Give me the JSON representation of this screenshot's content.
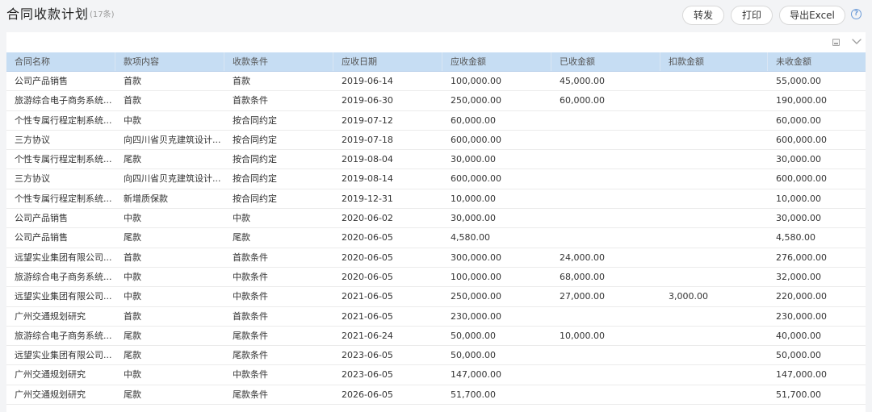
{
  "header": {
    "title": "合同收款计划",
    "count": "(17条)",
    "buttons": {
      "forward": "转发",
      "print": "打印",
      "export": "导出Excel"
    },
    "help_glyph": "?"
  },
  "toolbar": {
    "icons": [
      "print-icon",
      "chevron-down-icon"
    ]
  },
  "colors": {
    "header_bg": "#c6ddf3",
    "accent": "#6b9bd8"
  },
  "table": {
    "columns": [
      "合同名称",
      "款项内容",
      "收款条件",
      "应收日期",
      "应收金额",
      "已收金额",
      "扣款金额",
      "未收金额"
    ],
    "rows": [
      [
        "公司产品销售",
        "首款",
        "首款",
        "2019-06-14",
        "100,000.00",
        "45,000.00",
        "",
        "55,000.00"
      ],
      [
        "旅游综合电子商务系统...",
        "首款",
        "首款条件",
        "2019-06-30",
        "250,000.00",
        "60,000.00",
        "",
        "190,000.00"
      ],
      [
        "个性专属行程定制系统...",
        "中款",
        "按合同约定",
        "2019-07-12",
        "60,000.00",
        "",
        "",
        "60,000.00"
      ],
      [
        "三方协议",
        "向四川省贝克建筑设计...",
        "按合同约定",
        "2019-07-18",
        "600,000.00",
        "",
        "",
        "600,000.00"
      ],
      [
        "个性专属行程定制系统...",
        "尾款",
        "按合同约定",
        "2019-08-04",
        "30,000.00",
        "",
        "",
        "30,000.00"
      ],
      [
        "三方协议",
        "向四川省贝克建筑设计...",
        "按合同约定",
        "2019-08-14",
        "600,000.00",
        "",
        "",
        "600,000.00"
      ],
      [
        "个性专属行程定制系统...",
        "新增质保款",
        "按合同约定",
        "2019-12-31",
        "10,000.00",
        "",
        "",
        "10,000.00"
      ],
      [
        "公司产品销售",
        "中款",
        "中款",
        "2020-06-02",
        "30,000.00",
        "",
        "",
        "30,000.00"
      ],
      [
        "公司产品销售",
        "尾款",
        "尾款",
        "2020-06-05",
        "4,580.00",
        "",
        "",
        "4,580.00"
      ],
      [
        "远望实业集团有限公司...",
        "首款",
        "首款条件",
        "2020-06-05",
        "300,000.00",
        "24,000.00",
        "",
        "276,000.00"
      ],
      [
        "旅游综合电子商务系统...",
        "中款",
        "中款条件",
        "2020-06-05",
        "100,000.00",
        "68,000.00",
        "",
        "32,000.00"
      ],
      [
        "远望实业集团有限公司...",
        "中款",
        "中款条件",
        "2021-06-05",
        "250,000.00",
        "27,000.00",
        "3,000.00",
        "220,000.00"
      ],
      [
        "广州交通规划研究",
        "首款",
        "首款条件",
        "2021-06-05",
        "230,000.00",
        "",
        "",
        "230,000.00"
      ],
      [
        "旅游综合电子商务系统...",
        "尾款",
        "尾款条件",
        "2021-06-24",
        "50,000.00",
        "10,000.00",
        "",
        "40,000.00"
      ],
      [
        "远望实业集团有限公司...",
        "尾款",
        "尾款条件",
        "2023-06-05",
        "50,000.00",
        "",
        "",
        "50,000.00"
      ],
      [
        "广州交通规划研究",
        "中款",
        "中款条件",
        "2023-06-05",
        "147,000.00",
        "",
        "",
        "147,000.00"
      ],
      [
        "广州交通规划研究",
        "尾款",
        "尾款条件",
        "2026-06-05",
        "51,700.00",
        "",
        "",
        "51,700.00"
      ]
    ]
  }
}
